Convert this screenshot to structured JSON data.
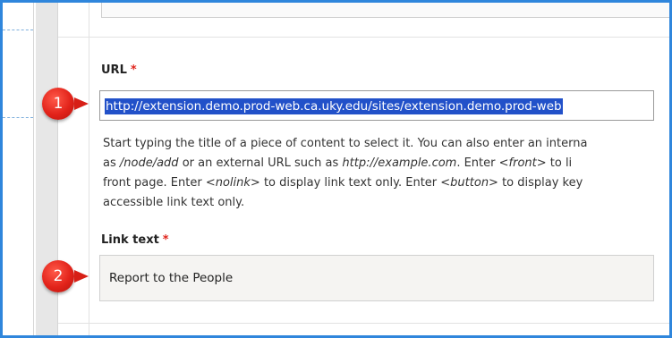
{
  "url_field": {
    "label": "URL",
    "required_marker": "*",
    "value": "http://extension.demo.prod-web.ca.uky.edu/sites/extension.demo.prod-web",
    "help_lines": [
      [
        "Start typing the title of a piece of content to select it. You can also enter an interna"
      ],
      [
        "as ",
        "/node/add",
        " or an external URL such as ",
        "http://example.com",
        ". Enter ",
        "<front>",
        " to li"
      ],
      [
        "front page. Enter ",
        "<nolink>",
        " to display link text only. Enter ",
        "<button>",
        " to display key"
      ],
      [
        "accessible link text only."
      ]
    ]
  },
  "link_text_field": {
    "label": "Link text",
    "required_marker": "*",
    "value": "Report to the People"
  },
  "callouts": [
    {
      "number": "1",
      "color": "#e2231a"
    },
    {
      "number": "2",
      "color": "#e2231a"
    }
  ],
  "colors": {
    "frame_border": "#2f86dc",
    "selection": "#2251c9",
    "required": "#e0261d"
  }
}
